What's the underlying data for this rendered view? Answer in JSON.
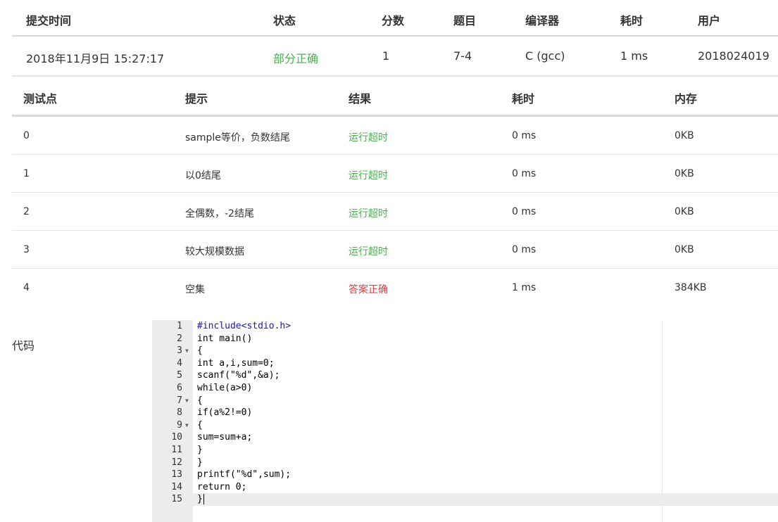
{
  "summary": {
    "headers": [
      "提交时间",
      "状态",
      "分数",
      "题目",
      "编译器",
      "耗时",
      "用户"
    ],
    "row": {
      "time": "2018年11月9日 15:27:17",
      "status": "部分正确",
      "score": "1",
      "problem": "7-4",
      "compiler": "C (gcc)",
      "duration": "1 ms",
      "user": "2018024019"
    }
  },
  "cases": {
    "headers": [
      "测试点",
      "提示",
      "结果",
      "耗时",
      "内存"
    ],
    "rows": [
      {
        "id": "0",
        "hint": "sample等价，负数结尾",
        "result": "运行超时",
        "time": "0 ms",
        "memory": "0KB"
      },
      {
        "id": "1",
        "hint": "以0结尾",
        "result": "运行超时",
        "time": "0 ms",
        "memory": "0KB"
      },
      {
        "id": "2",
        "hint": "全偶数，-2结尾",
        "result": "运行超时",
        "time": "0 ms",
        "memory": "0KB"
      },
      {
        "id": "3",
        "hint": "较大规模数据",
        "result": "运行超时",
        "time": "0 ms",
        "memory": "0KB"
      },
      {
        "id": "4",
        "hint": "空集",
        "result": "答案正确",
        "time": "1 ms",
        "memory": "384KB"
      }
    ]
  },
  "code_label": "代码",
  "code_lines": [
    "#include<stdio.h>",
    "int main()",
    "{",
    "int a,i,sum=0;",
    "scanf(\"%d\",&a);",
    "while(a>0)",
    "{",
    "if(a%2!=0)",
    "{",
    "sum=sum+a;",
    "}",
    "}",
    "printf(\"%d\",sum);",
    "return 0;",
    "}"
  ],
  "colors": {
    "partial_correct": "#4caf50",
    "timeout": "#4caf50",
    "correct": "#d9413c"
  }
}
